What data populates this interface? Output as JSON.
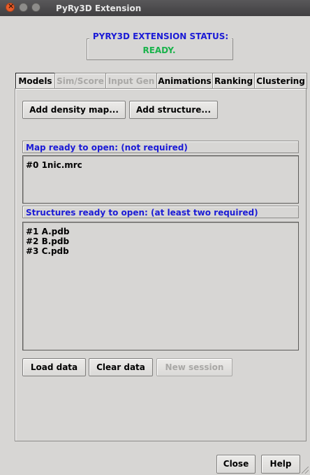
{
  "window": {
    "title": "PyRy3D Extension"
  },
  "status": {
    "title": "PYRY3D EXTENSION STATUS:",
    "value": "READY."
  },
  "tabs": [
    {
      "label": "Models",
      "state": "active"
    },
    {
      "label": "Sim/Score",
      "state": "disabled"
    },
    {
      "label": "Input Gen",
      "state": "disabled"
    },
    {
      "label": "Animations",
      "state": "enabled"
    },
    {
      "label": "Ranking",
      "state": "enabled"
    },
    {
      "label": "Clustering",
      "state": "enabled"
    }
  ],
  "models": {
    "add_density_map_label": "Add density map...",
    "add_structure_label": "Add structure...",
    "map_section_label": "Map ready to open: (not required)",
    "map_items": [
      "#0 1nic.mrc"
    ],
    "structures_section_label": "Structures ready to open: (at least two required)",
    "structure_items": [
      "#1 A.pdb",
      "#2 B.pdb",
      "#3 C.pdb"
    ],
    "load_data_label": "Load data",
    "clear_data_label": "Clear data",
    "new_session_label": "New session"
  },
  "footer": {
    "close_label": "Close",
    "help_label": "Help"
  },
  "colors": {
    "status_title": "#1b1bd6",
    "status_ready": "#19b34b",
    "section_label": "#1b1bd6"
  }
}
